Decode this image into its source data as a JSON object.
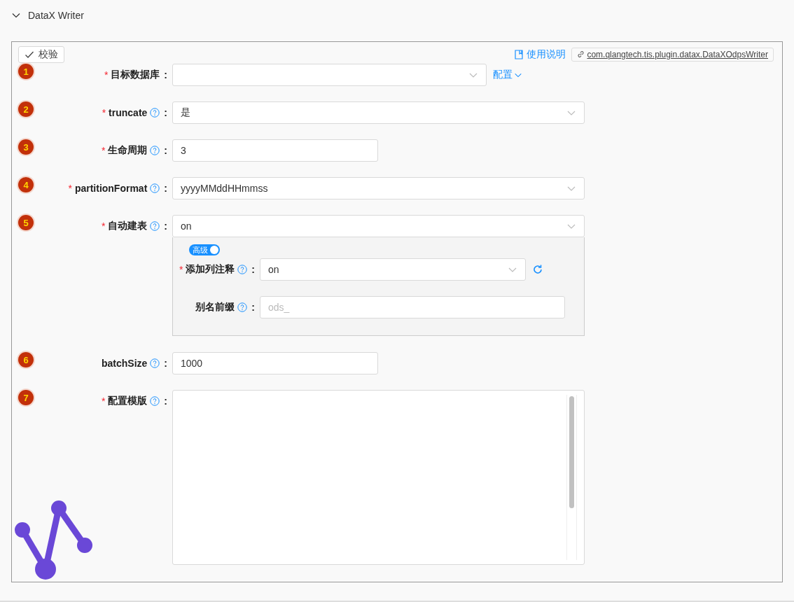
{
  "section": {
    "title": "DataX Writer",
    "expanded": true
  },
  "toolbar": {
    "validate_button": "校验",
    "doc_link": "使用说明",
    "plugin_link": "com.qlangtech.tis.plugin.datax.DataXOdpsWriter"
  },
  "fields": [
    {
      "badge": "1",
      "required_mark": "*",
      "label": "目标数据库",
      "help": false,
      "colon": ":",
      "kind": "select",
      "extra_link": "配置"
    },
    {
      "badge": "2",
      "required_mark": "*",
      "label": "truncate",
      "help": true,
      "colon": ":",
      "kind": "select",
      "value": "是"
    },
    {
      "badge": "3",
      "required_mark": "*",
      "label": "生命周期",
      "help": true,
      "colon": ":",
      "kind": "input",
      "value": "3"
    },
    {
      "badge": "4",
      "required_mark": "*",
      "label": "partitionFormat",
      "help": true,
      "colon": ":",
      "kind": "select",
      "value": "yyyyMMddHHmmss"
    },
    {
      "badge": "5",
      "required_mark": "*",
      "label": "自动建表",
      "help": true,
      "colon": ":",
      "kind": "select",
      "value": "on",
      "advanced": {
        "toggle_label": "高级",
        "on": true,
        "fields": [
          {
            "required_mark": "*",
            "label": "添加列注释",
            "help": true,
            "colon": ":",
            "kind": "select",
            "value": "on",
            "refresh": true
          },
          {
            "label": "别名前缀",
            "help": true,
            "colon": ":",
            "kind": "input",
            "placeholder": "ods_"
          }
        ]
      }
    },
    {
      "badge": "6",
      "label": "batchSize",
      "help": true,
      "colon": ":",
      "kind": "input",
      "value": "1000"
    },
    {
      "badge": "7",
      "required_mark": "*",
      "label": "配置模版",
      "help": true,
      "colon": ":",
      "kind": "textarea"
    }
  ]
}
